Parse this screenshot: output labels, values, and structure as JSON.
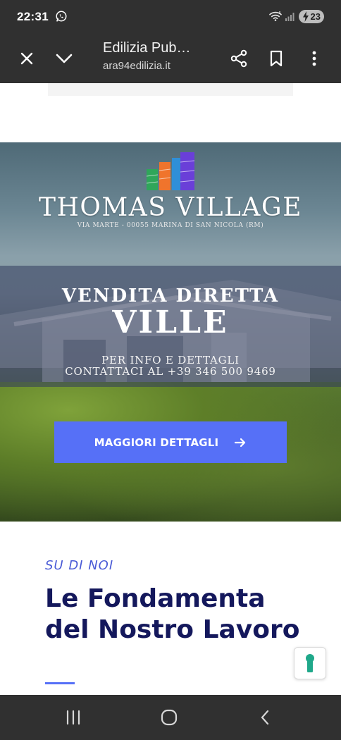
{
  "status_bar": {
    "time": "22:31",
    "battery_level": "23",
    "icons": [
      "whatsapp-icon",
      "wifi-icon",
      "signal-icon",
      "battery-charging-icon"
    ]
  },
  "browser": {
    "title": "Edilizia Pub…",
    "url": "ara94edilizia.it",
    "icons": [
      "close-icon",
      "chevron-down-icon",
      "share-icon",
      "bookmark-icon",
      "more-vert-icon"
    ]
  },
  "hero": {
    "brand_name": "THOMAS VILLAGE",
    "address": "VIA MARTE - 00055 MARINA DI SAN NICOLA (RM)",
    "headline_line1": "VENDITA DIRETTA",
    "headline_line2": "VILLE",
    "info_line1": "PER INFO E DETTAGLI",
    "info_line2": "CONTATTACI AL +39 346 500 9469",
    "cta_label": "MAGGIORI DETTAGLI",
    "logo_colors": [
      "#2fa65a",
      "#f0742c",
      "#2f8fd8",
      "#6a3fd8"
    ]
  },
  "about": {
    "kicker": "SU DI NOI",
    "title": "Le Fondamenta del Nostro Lavoro"
  },
  "colors": {
    "accent": "#5670f7",
    "title_navy": "#14185c",
    "system_bar": "#303030",
    "lock_green": "#1fa88a"
  },
  "nav_bar": {
    "icons": [
      "recent-apps-icon",
      "home-icon",
      "back-icon"
    ]
  }
}
